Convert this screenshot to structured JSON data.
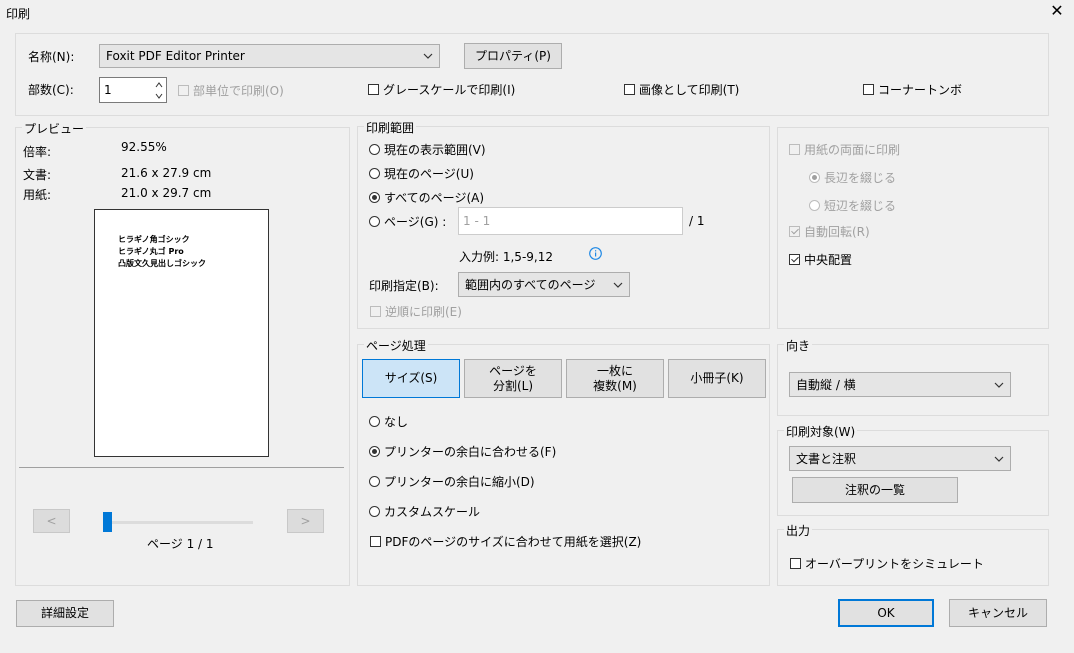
{
  "window": {
    "title": "印刷"
  },
  "printer": {
    "name_label": "名称(N):",
    "name_value": "Foxit PDF Editor Printer",
    "properties_button": "プロパティ(P)",
    "copies_label": "部数(C):",
    "copies_value": "1",
    "collate_label": "部単位で印刷(O)",
    "grayscale_label": "グレースケールで印刷(I)",
    "as_image_label": "画像として印刷(T)",
    "corner_marks_label": "コーナートンボ"
  },
  "preview": {
    "label": "プレビュー",
    "zoom_label": "倍率:",
    "zoom_value": "92.55%",
    "doc_label": "文書:",
    "doc_value": "21.6 x 27.9 cm",
    "paper_label": "用紙:",
    "paper_value": "21.0 x 29.7 cm",
    "page_lines": [
      "ヒラギノ角ゴシック",
      "ヒラギノ丸ゴ Pro",
      "凸版文久見出しゴシック"
    ],
    "prev_button": "<",
    "next_button": ">",
    "page_indicator": "ページ 1 / 1"
  },
  "print_range": {
    "label": "印刷範囲",
    "current_view": "現在の表示範囲(V)",
    "current_page": "現在のページ(U)",
    "all_pages": "すべてのページ(A)",
    "pages": "ページ(G) :",
    "pages_input_placeholder": "1 - 1",
    "pages_total": "/ 1",
    "example": "入力例: 1,5-9,12",
    "subset_label": "印刷指定(B):",
    "subset_value": "範囲内のすべてのページ",
    "reverse_label": "逆順に印刷(E)"
  },
  "duplex": {
    "both_sides": "用紙の両面に印刷",
    "long_edge": "長辺を綴じる",
    "short_edge": "短辺を綴じる",
    "auto_rotate": "自動回転(R)",
    "center": "中央配置"
  },
  "page_handling": {
    "label": "ページ処理",
    "tabs": [
      "サイズ(S)",
      "ページを\n分割(L)",
      "一枚に\n複数(M)",
      "小冊子(K)"
    ],
    "none": "なし",
    "fit": "プリンターの余白に合わせる(F)",
    "shrink": "プリンターの余白に縮小(D)",
    "custom": "カスタムスケール",
    "choose_paper": "PDFのページのサイズに合わせて用紙を選択(Z)"
  },
  "orientation": {
    "label": "向き",
    "value": "自動縦 / 横"
  },
  "print_what": {
    "label": "印刷対象(W)",
    "value": "文書と注釈",
    "summarize_button": "注釈の一覧"
  },
  "output": {
    "label": "出力",
    "simulate_overprint": "オーバープリントをシミュレート"
  },
  "footer": {
    "advanced": "詳細設定",
    "ok": "OK",
    "cancel": "キャンセル"
  },
  "colors": {
    "accent": "#0078d7",
    "info": "#1e88e5"
  }
}
